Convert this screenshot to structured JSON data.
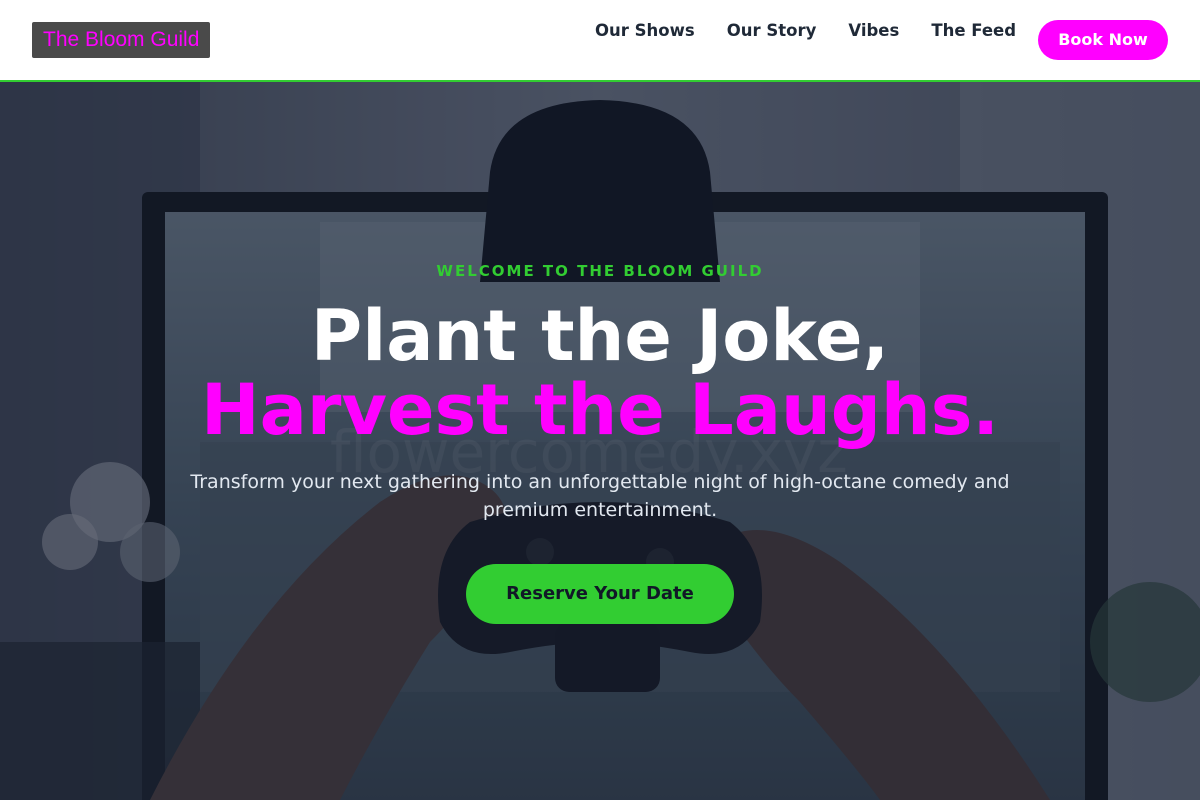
{
  "header": {
    "logo_text": "The Bloom Guild",
    "nav": [
      {
        "label": "Our Shows"
      },
      {
        "label": "Our Story"
      },
      {
        "label": "Vibes"
      },
      {
        "label": "The Feed"
      }
    ],
    "book_button": "Book Now"
  },
  "hero": {
    "eyebrow": "WELCOME TO THE BLOOM GUILD",
    "headline_line1": "Plant the Joke,",
    "headline_line2": "Harvest the Laughs.",
    "subtitle": "Transform your next gathering into an unforgettable night of high-octane comedy and premium entertainment.",
    "cta_label": "Reserve Your Date",
    "background_image": "hands holding game controller in front of monitor"
  },
  "colors": {
    "accent_magenta": "#ff00ff",
    "accent_green": "#32cd32",
    "nav_text": "#1f2937",
    "header_bg": "#ffffff",
    "overlay": "#0f172a"
  }
}
